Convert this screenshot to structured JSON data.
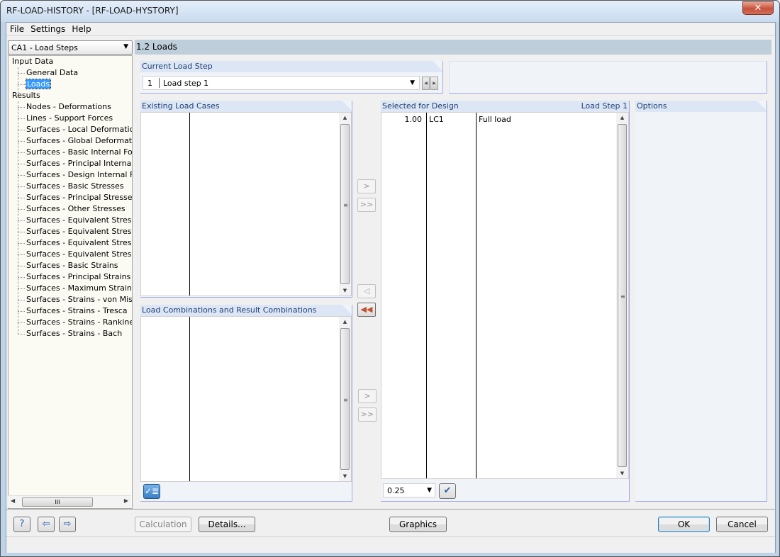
{
  "window": {
    "title": "RF-LOAD-HISTORY - [RF-LOAD-HYSTORY]",
    "close_icon": "close-icon"
  },
  "menu": [
    "File",
    "Settings",
    "Help"
  ],
  "nav": {
    "combo_value": "CA1 - Load Steps",
    "tree": {
      "input_data": {
        "label": "Input Data",
        "items": [
          "General Data",
          "Loads"
        ],
        "selected": "Loads"
      },
      "results": {
        "label": "Results",
        "items": [
          "Nodes - Deformations",
          "Lines - Support Forces",
          "Surfaces - Local Deformations",
          "Surfaces - Global Deformations",
          "Surfaces - Basic Internal Forces",
          "Surfaces - Principal Internal Forces",
          "Surfaces - Design Internal Forces",
          "Surfaces - Basic Stresses",
          "Surfaces - Principal Stresses",
          "Surfaces - Other Stresses",
          "Surfaces - Equivalent Stresses",
          "Surfaces - Equivalent Stresses",
          "Surfaces - Equivalent Stresses",
          "Surfaces - Equivalent Stresses",
          "Surfaces - Basic Strains",
          "Surfaces - Principal Strains",
          "Surfaces - Maximum Strains",
          "Surfaces - Strains - von Mises",
          "Surfaces - Strains - Tresca",
          "Surfaces - Strains - Rankine",
          "Surfaces - Strains - Bach"
        ]
      }
    }
  },
  "main": {
    "section_title": "1.2 Loads",
    "current_load_step": {
      "label": "Current Load Step",
      "number": "1",
      "name": "Load step 1"
    },
    "existing_load_cases": {
      "label": "Existing Load Cases",
      "rows": []
    },
    "load_combinations": {
      "label": "Load Combinations and Result Combinations",
      "rows": []
    },
    "selected_for_design": {
      "label": "Selected for Design",
      "right_label": "Load Step 1",
      "rows": [
        {
          "factor": "1.00",
          "case": "LC1",
          "description": "Full load"
        }
      ],
      "factor_value": "0.25"
    },
    "options": {
      "label": "Options"
    },
    "transfer_buttons": {
      "add": ">",
      "add_all": ">>",
      "remove": "<",
      "remove_all": "<<"
    }
  },
  "footer": {
    "calculation": "Calculation",
    "details": "Details...",
    "graphics": "Graphics",
    "ok": "OK",
    "cancel": "Cancel"
  }
}
